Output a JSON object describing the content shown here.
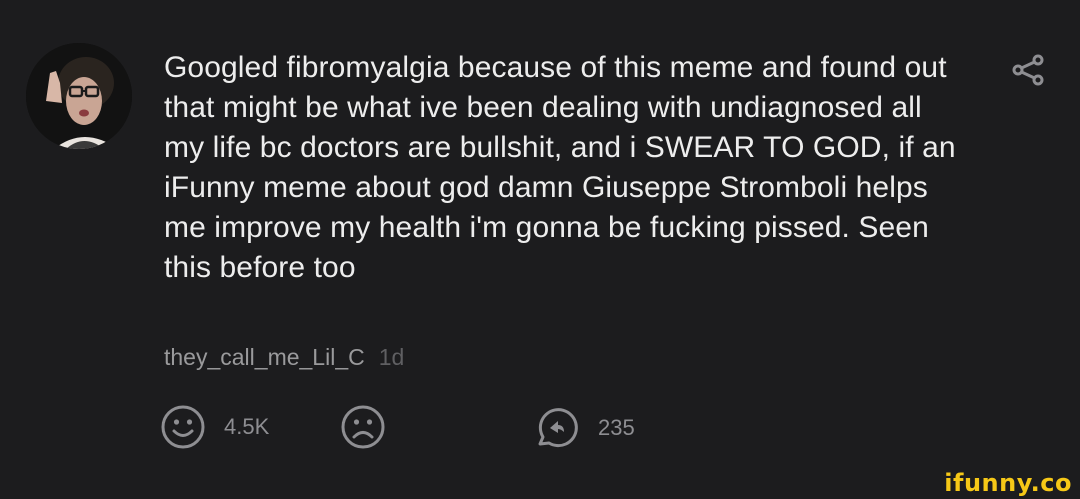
{
  "comment": {
    "text": "Googled fibromyalgia because of this meme and found out that might be what ive been dealing with undiagnosed all my life bc doctors are bullshit, and i SWEAR TO GOD, if an iFunny meme about god damn Giuseppe Stromboli helps me improve my health i'm gonna be fucking pissed. Seen this before too",
    "username": "they_call_me_Lil_C",
    "time": "1d"
  },
  "actions": {
    "like_count": "4.5K",
    "reply_count": "235"
  },
  "icons": {
    "share": "share-icon",
    "like": "smile-icon",
    "dislike": "frown-icon",
    "reply": "reply-icon"
  },
  "watermark": "ifunny.co",
  "colors": {
    "background": "#1c1c1e",
    "text": "#ededed",
    "username": "#9a9a9c",
    "time": "#5f5f62",
    "icon": "#8e8e92",
    "watermark": "#f6c817"
  }
}
